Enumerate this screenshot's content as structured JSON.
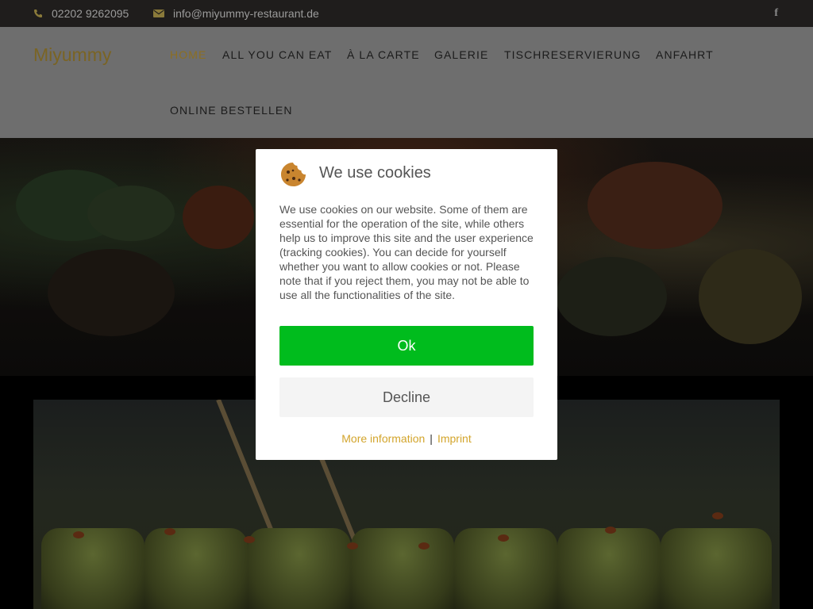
{
  "topbar": {
    "phone": "02202 9262095",
    "email": "info@miyummy-restaurant.de",
    "phone_icon": "phone-icon",
    "email_icon": "envelope-icon",
    "social_icon": "facebook-icon",
    "social_glyph": "f"
  },
  "header": {
    "logo": "Miyummy",
    "nav": [
      {
        "label": "HOME",
        "active": true
      },
      {
        "label": "ALL YOU CAN EAT"
      },
      {
        "label": "À LA CARTE"
      },
      {
        "label": "GALERIE"
      },
      {
        "label": "TISCHRESERVIERUNG"
      },
      {
        "label": "ANFAHRT"
      },
      {
        "label": "ONLINE BESTELLEN"
      }
    ]
  },
  "cookie_modal": {
    "icon": "cookie-icon",
    "title": "We use cookies",
    "body": "We use cookies on our website. Some of them are essential for the operation of the site, while others help us to improve this site and the user experience (tracking cookies). You can decide for yourself whether you want to allow cookies or not. Please note that if you reject them, you may not be able to use all the functionalities of the site.",
    "ok_label": "Ok",
    "decline_label": "Decline",
    "more_info_label": "More information",
    "separator": "|",
    "imprint_label": "Imprint"
  },
  "colors": {
    "accent": "#d3a52c",
    "ok_green": "#00bc1d",
    "topbar_bg": "#1f1d1c"
  }
}
